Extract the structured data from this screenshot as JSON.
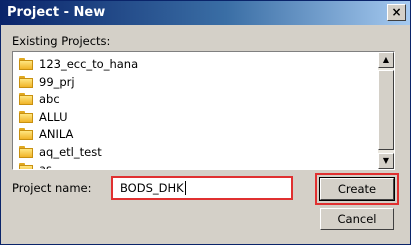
{
  "window": {
    "title": "Project - New",
    "close_symbol": "×"
  },
  "labels": {
    "existing_projects": "Existing Projects:",
    "project_name": "Project name:"
  },
  "projects": [
    "123_ecc_to_hana",
    "99_prj",
    "abc",
    "ALLU",
    "ANILA",
    "aq_etl_test",
    "as"
  ],
  "project_name_field": {
    "value": "BODS_DHK"
  },
  "buttons": {
    "create": "Create",
    "cancel": "Cancel"
  },
  "scroll_symbols": {
    "up": "▲",
    "down": "▼"
  },
  "colors": {
    "title_bar_start": "#0a246a",
    "highlight_box": "#e03030",
    "dialog_bg": "#d4d0c8",
    "folder": "#f0b428"
  }
}
